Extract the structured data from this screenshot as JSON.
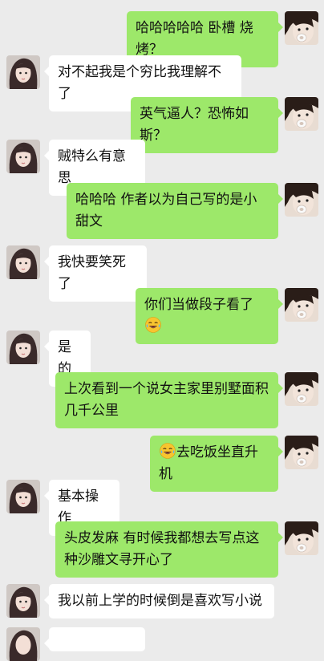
{
  "colors": {
    "background": "#ebebeb",
    "incoming_bubble": "#ffffff",
    "outgoing_bubble": "#9de86a"
  },
  "messages": [
    {
      "side": "right",
      "text": "哈哈哈哈哈 卧槽 烧烤？"
    },
    {
      "side": "left",
      "text": "对不起我是个穷比我理解不了"
    },
    {
      "side": "right",
      "text": "英气逼人？恐怖如斯？"
    },
    {
      "side": "left",
      "text": "贼特么有意思"
    },
    {
      "side": "right",
      "text": "哈哈哈 作者以为自己写的是小甜文"
    },
    {
      "side": "left",
      "text": "我快要笑死了"
    },
    {
      "side": "right",
      "text": "你们当做段子看了",
      "emoji_after": "face-with-tears-of-joy-icon"
    },
    {
      "side": "left",
      "text": "是的"
    },
    {
      "side": "right",
      "text": "上次看到一个说女主家里别墅面积几千公里"
    },
    {
      "side": "right",
      "emoji_before": "face-with-tears-of-joy-icon",
      "text": "去吃饭坐直升机"
    },
    {
      "side": "left",
      "text": "基本操作"
    },
    {
      "side": "right",
      "text": "头皮发麻 有时候我都想去写点这种沙雕文寻开心了"
    },
    {
      "side": "left",
      "text": "我以前上学的时候倒是喜欢写小说"
    }
  ]
}
